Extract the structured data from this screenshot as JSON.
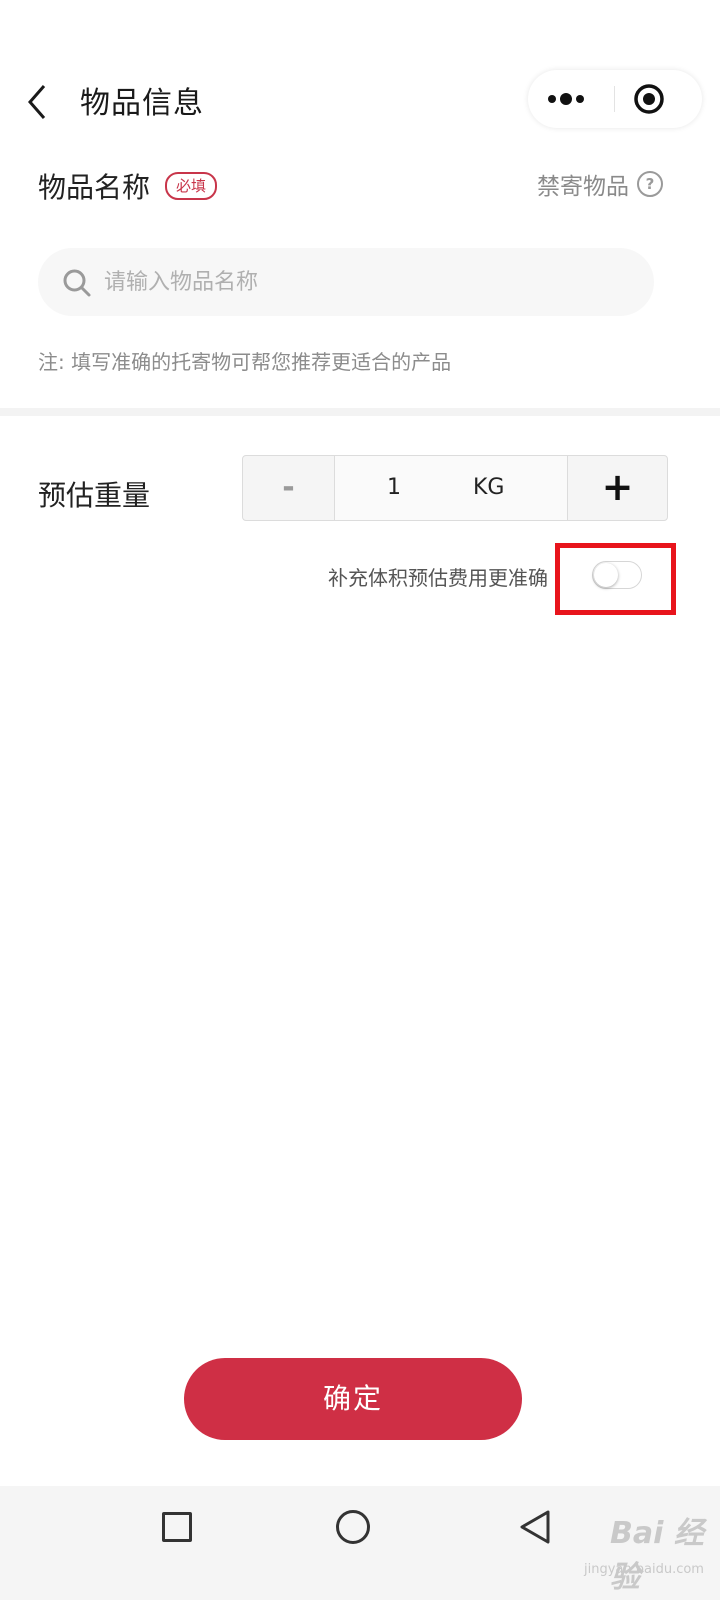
{
  "header": {
    "title": "物品信息",
    "icons": {
      "back": "chevron-left-icon",
      "more": "more-dots-icon",
      "close": "target-circle-icon"
    }
  },
  "item_name": {
    "label": "物品名称",
    "required_badge": "必填",
    "prohibited_link": "禁寄物品",
    "help_icon_glyph": "?",
    "search_placeholder": "请输入物品名称",
    "search_value": "",
    "note": "注: 填写准确的托寄物可帮您推荐更适合的产品"
  },
  "weight": {
    "label": "预估重量",
    "minus_label": "-",
    "value": "1",
    "unit": "KG",
    "plus_label": "+"
  },
  "volume": {
    "text": "补充体积预估费用更准确",
    "toggle_on": false
  },
  "confirm_label": "确定",
  "navbar": {
    "icons": [
      "square-icon",
      "circle-icon",
      "triangle-back-icon"
    ]
  },
  "watermark": {
    "text": "Bai 经验",
    "sub": "jingyan.baidu.com"
  },
  "colors": {
    "accent": "#cf2f45",
    "highlight": "#e8141c"
  }
}
